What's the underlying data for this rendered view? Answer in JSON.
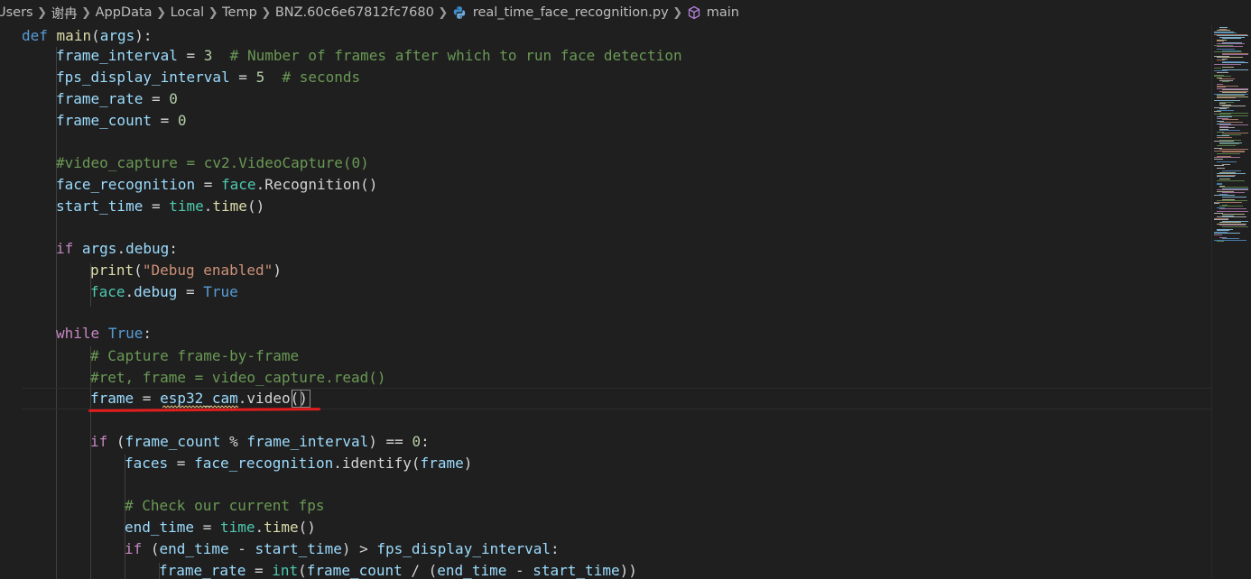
{
  "breadcrumb": {
    "items": [
      "Users",
      "谢冉",
      "AppData",
      "Local",
      "Temp",
      "BNZ.60c6e67812fc7680"
    ],
    "file": "real_time_face_recognition.py",
    "symbol": "main"
  },
  "icons": {
    "separator": "chevron-right-icon",
    "file": "python-file-icon",
    "symbol": "symbol-method-icon"
  },
  "colors": {
    "background": "#1f1f1f",
    "annotation_underline": "#e31c1c",
    "keyword": "#569cd6",
    "control": "#c586c0",
    "function": "#dcdcaa",
    "variable": "#9cdcfe",
    "class": "#4ec9b0",
    "number": "#b5cea8",
    "string": "#ce9178",
    "comment": "#6a9955"
  },
  "code": {
    "l1": {
      "t1": "def",
      "t2": " ",
      "t3": "main",
      "t4": "(",
      "t5": "args",
      "t6": "):"
    },
    "l2": {
      "t1": "frame_interval",
      "t2": " = ",
      "t3": "3",
      "t4": "  ",
      "t5": "# Number of frames after which to run face detection"
    },
    "l3": {
      "t1": "fps_display_interval",
      "t2": " = ",
      "t3": "5",
      "t4": "  ",
      "t5": "# seconds"
    },
    "l4": {
      "t1": "frame_rate",
      "t2": " = ",
      "t3": "0"
    },
    "l5": {
      "t1": "frame_count",
      "t2": " = ",
      "t3": "0"
    },
    "l7": {
      "t1": "#video_capture = cv2.VideoCapture(0)"
    },
    "l8": {
      "t1": "face_recognition",
      "t2": " = ",
      "t3": "face",
      "t4": ".",
      "t5": "Recognition",
      "t6": "()"
    },
    "l9": {
      "t1": "start_time",
      "t2": " = ",
      "t3": "time",
      "t4": ".",
      "t5": "time",
      "t6": "()"
    },
    "l11": {
      "t1": "if",
      "t2": " ",
      "t3": "args",
      "t4": ".",
      "t5": "debug",
      "t6": ":"
    },
    "l12": {
      "t1": "print",
      "t2": "(",
      "t3": "\"Debug enabled\"",
      "t4": ")"
    },
    "l13": {
      "t1": "face",
      "t2": ".",
      "t3": "debug",
      "t4": " = ",
      "t5": "True"
    },
    "l15": {
      "t1": "while",
      "t2": " ",
      "t3": "True",
      "t4": ":"
    },
    "l16": {
      "t1": "# Capture frame-by-frame"
    },
    "l17": {
      "t1": "#ret, frame = video_capture.read()"
    },
    "l18": {
      "t1": "frame",
      "t2": " = ",
      "t3": "esp32_cam",
      "t4": ".",
      "t5": "video",
      "t6": "()"
    },
    "l20": {
      "t1": "if",
      "t2": " (",
      "t3": "frame_count",
      "t4": " % ",
      "t5": "frame_interval",
      "t6": ") == ",
      "t7": "0",
      "t8": ":"
    },
    "l21": {
      "t1": "faces",
      "t2": " = ",
      "t3": "face_recognition",
      "t4": ".",
      "t5": "identify",
      "t6": "(",
      "t7": "frame",
      "t8": ")"
    },
    "l23": {
      "t1": "# Check our current fps"
    },
    "l24": {
      "t1": "end_time",
      "t2": " = ",
      "t3": "time",
      "t4": ".",
      "t5": "time",
      "t6": "()"
    },
    "l25": {
      "t1": "if",
      "t2": " (",
      "t3": "end_time",
      "t4": " - ",
      "t5": "start_time",
      "t6": ") > ",
      "t7": "fps_display_interval",
      "t8": ":"
    },
    "l26": {
      "t1": "frame_rate",
      "t2": " = ",
      "t3": "int",
      "t4": "(",
      "t5": "frame_count",
      "t6": " / (",
      "t7": "end_time",
      "t8": " - ",
      "t9": "start_time",
      "t10": "))"
    }
  }
}
